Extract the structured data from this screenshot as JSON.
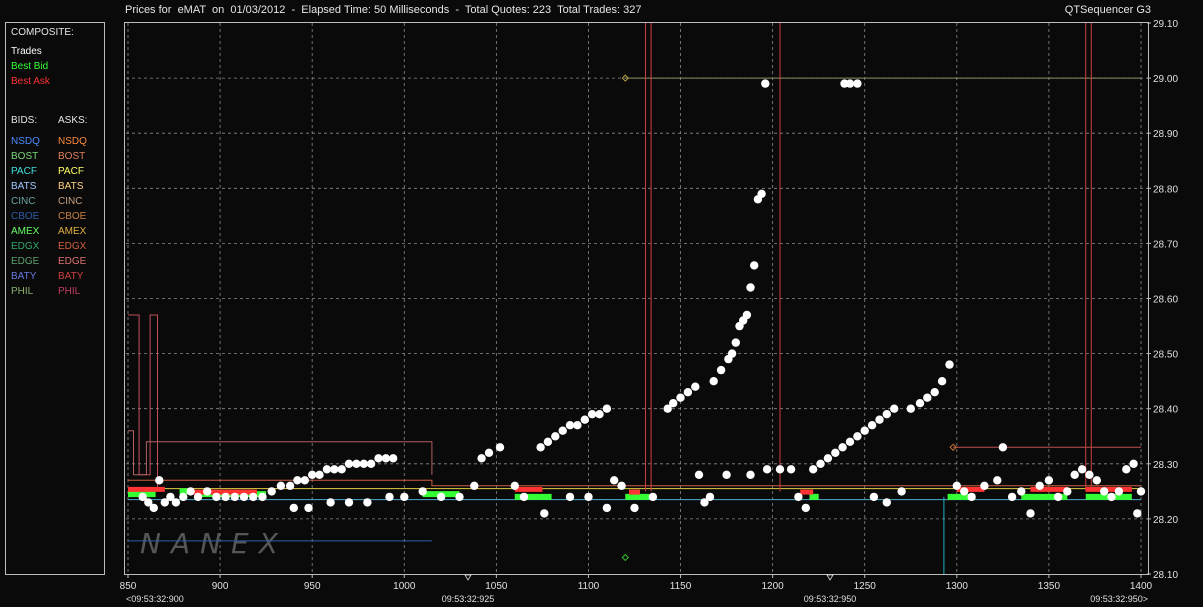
{
  "header": {
    "title": "Prices for  eMAT  on  01/03/2012  -  Elapsed Time: 50 Milliseconds  -  Total Quotes: 223  Total Trades: 327",
    "app_name": "QTSequencer G3"
  },
  "legend": {
    "composite_heading": "COMPOSITE:",
    "composite_items": [
      {
        "label": "Trades",
        "color": "#ffffff"
      },
      {
        "label": "Best Bid",
        "color": "#33ff33"
      },
      {
        "label": "Best Ask",
        "color": "#ff3333"
      }
    ],
    "bids_heading": "BIDS:",
    "asks_heading": "ASKS:",
    "exchanges": [
      {
        "bid": "NSDQ",
        "bid_color": "#4b8dff",
        "ask": "NSDQ",
        "ask_color": "#ff8c3a"
      },
      {
        "bid": "BOST",
        "bid_color": "#7ad77a",
        "ask": "BOST",
        "ask_color": "#e0805a"
      },
      {
        "bid": "PACF",
        "bid_color": "#40e0e0",
        "ask": "PACF",
        "ask_color": "#ffff66"
      },
      {
        "bid": "BATS",
        "bid_color": "#9fc8ff",
        "ask": "BATS",
        "ask_color": "#ffd080"
      },
      {
        "bid": "CINC",
        "bid_color": "#6aa6a6",
        "ask": "CINC",
        "ask_color": "#c8a080"
      },
      {
        "bid": "CBOE",
        "bid_color": "#2e5ea8",
        "ask": "CBOE",
        "ask_color": "#c88040"
      },
      {
        "bid": "AMEX",
        "bid_color": "#66ff66",
        "ask": "AMEX",
        "ask_color": "#e0b040"
      },
      {
        "bid": "EDGX",
        "bid_color": "#33a86a",
        "ask": "EDGX",
        "ask_color": "#d06040"
      },
      {
        "bid": "EDGE",
        "bid_color": "#5fa06f",
        "ask": "EDGE",
        "ask_color": "#e07070"
      },
      {
        "bid": "BATY",
        "bid_color": "#6a7ae0",
        "ask": "BATY",
        "ask_color": "#d04040"
      },
      {
        "bid": "PHIL",
        "bid_color": "#8ab070",
        "ask": "PHIL",
        "ask_color": "#c04060"
      }
    ]
  },
  "watermark": "NANEX",
  "chart_data": {
    "type": "scatter",
    "title": "Prices for  eMAT  on  01/03/2012",
    "x_ticks": [
      "850",
      "900",
      "950",
      "1000",
      "1050",
      "1100",
      "1150",
      "1200",
      "1250",
      "1300",
      "1350",
      "1400"
    ],
    "time_labels": [
      "<09:53:32:900",
      "09:53:32:925",
      "09:53:32:950",
      "09:53:32:950>"
    ],
    "y_ticks": [
      "28.10",
      "28.20",
      "28.30",
      "28.40",
      "28.50",
      "28.60",
      "28.70",
      "28.80",
      "28.90",
      "29.00",
      "29.10"
    ],
    "xlim": [
      850,
      1400
    ],
    "ylim": [
      28.1,
      29.1
    ],
    "grid": true,
    "series": [
      {
        "name": "Trades",
        "color": "#ffffff",
        "points": [
          [
            858,
            28.24
          ],
          [
            861,
            28.23
          ],
          [
            864,
            28.22
          ],
          [
            867,
            28.27
          ],
          [
            870,
            28.23
          ],
          [
            873,
            28.24
          ],
          [
            876,
            28.23
          ],
          [
            880,
            28.24
          ],
          [
            884,
            28.25
          ],
          [
            888,
            28.24
          ],
          [
            893,
            28.25
          ],
          [
            898,
            28.24
          ],
          [
            903,
            28.24
          ],
          [
            908,
            28.24
          ],
          [
            913,
            28.24
          ],
          [
            918,
            28.24
          ],
          [
            923,
            28.24
          ],
          [
            928,
            28.25
          ],
          [
            933,
            28.26
          ],
          [
            938,
            28.26
          ],
          [
            942,
            28.27
          ],
          [
            946,
            28.27
          ],
          [
            950,
            28.28
          ],
          [
            954,
            28.28
          ],
          [
            958,
            28.29
          ],
          [
            962,
            28.29
          ],
          [
            966,
            28.29
          ],
          [
            970,
            28.3
          ],
          [
            974,
            28.3
          ],
          [
            978,
            28.3
          ],
          [
            982,
            28.3
          ],
          [
            986,
            28.31
          ],
          [
            990,
            28.31
          ],
          [
            994,
            28.31
          ],
          [
            940,
            28.22
          ],
          [
            948,
            28.22
          ],
          [
            960,
            28.23
          ],
          [
            970,
            28.23
          ],
          [
            980,
            28.23
          ],
          [
            992,
            28.24
          ],
          [
            1000,
            28.24
          ],
          [
            1010,
            28.25
          ],
          [
            1020,
            28.24
          ],
          [
            1030,
            28.24
          ],
          [
            1038,
            28.26
          ],
          [
            1042,
            28.31
          ],
          [
            1046,
            28.32
          ],
          [
            1052,
            28.33
          ],
          [
            1060,
            28.26
          ],
          [
            1065,
            28.24
          ],
          [
            1074,
            28.33
          ],
          [
            1078,
            28.34
          ],
          [
            1082,
            28.35
          ],
          [
            1086,
            28.36
          ],
          [
            1090,
            28.37
          ],
          [
            1094,
            28.37
          ],
          [
            1098,
            28.38
          ],
          [
            1102,
            28.39
          ],
          [
            1106,
            28.39
          ],
          [
            1110,
            28.4
          ],
          [
            1114,
            28.27
          ],
          [
            1118,
            28.26
          ],
          [
            1076,
            28.21
          ],
          [
            1090,
            28.24
          ],
          [
            1100,
            28.24
          ],
          [
            1110,
            28.22
          ],
          [
            1125,
            28.22
          ],
          [
            1135,
            28.24
          ],
          [
            1143,
            28.4
          ],
          [
            1146,
            28.41
          ],
          [
            1150,
            28.42
          ],
          [
            1154,
            28.43
          ],
          [
            1158,
            28.44
          ],
          [
            1163,
            28.23
          ],
          [
            1166,
            28.24
          ],
          [
            1168,
            28.45
          ],
          [
            1172,
            28.47
          ],
          [
            1176,
            28.49
          ],
          [
            1178,
            28.5
          ],
          [
            1180,
            28.52
          ],
          [
            1182,
            28.55
          ],
          [
            1184,
            28.56
          ],
          [
            1186,
            28.57
          ],
          [
            1188,
            28.62
          ],
          [
            1190,
            28.66
          ],
          [
            1192,
            28.78
          ],
          [
            1194,
            28.79
          ],
          [
            1196,
            28.99
          ],
          [
            1160,
            28.28
          ],
          [
            1175,
            28.28
          ],
          [
            1188,
            28.28
          ],
          [
            1197,
            28.29
          ],
          [
            1204,
            28.29
          ],
          [
            1210,
            28.29
          ],
          [
            1214,
            28.24
          ],
          [
            1218,
            28.22
          ],
          [
            1222,
            28.29
          ],
          [
            1226,
            28.3
          ],
          [
            1230,
            28.31
          ],
          [
            1234,
            28.32
          ],
          [
            1238,
            28.33
          ],
          [
            1242,
            28.34
          ],
          [
            1246,
            28.35
          ],
          [
            1250,
            28.36
          ],
          [
            1254,
            28.37
          ],
          [
            1258,
            28.38
          ],
          [
            1262,
            28.39
          ],
          [
            1266,
            28.4
          ],
          [
            1239,
            28.99
          ],
          [
            1242,
            28.99
          ],
          [
            1246,
            28.99
          ],
          [
            1255,
            28.24
          ],
          [
            1262,
            28.23
          ],
          [
            1270,
            28.25
          ],
          [
            1275,
            28.4
          ],
          [
            1280,
            28.41
          ],
          [
            1284,
            28.42
          ],
          [
            1288,
            28.43
          ],
          [
            1292,
            28.45
          ],
          [
            1296,
            28.48
          ],
          [
            1300,
            28.26
          ],
          [
            1304,
            28.25
          ],
          [
            1308,
            28.24
          ],
          [
            1315,
            28.26
          ],
          [
            1322,
            28.27
          ],
          [
            1325,
            28.33
          ],
          [
            1330,
            28.24
          ],
          [
            1335,
            28.25
          ],
          [
            1340,
            28.21
          ],
          [
            1345,
            28.26
          ],
          [
            1350,
            28.27
          ],
          [
            1355,
            28.24
          ],
          [
            1360,
            28.25
          ],
          [
            1364,
            28.28
          ],
          [
            1368,
            28.29
          ],
          [
            1372,
            28.28
          ],
          [
            1376,
            28.27
          ],
          [
            1380,
            28.25
          ],
          [
            1384,
            28.24
          ],
          [
            1388,
            28.25
          ],
          [
            1392,
            28.29
          ],
          [
            1396,
            28.3
          ],
          [
            1398,
            28.21
          ],
          [
            1400,
            28.25
          ]
        ]
      },
      {
        "name": "Best Bid",
        "color": "#33ff33",
        "segments": [
          [
            850,
            865,
            28.245
          ],
          [
            878,
            885,
            28.25
          ],
          [
            890,
            925,
            28.245
          ],
          [
            1010,
            1030,
            28.245
          ],
          [
            1060,
            1080,
            28.24
          ],
          [
            1120,
            1133,
            28.24
          ],
          [
            1220,
            1225,
            28.24
          ],
          [
            1295,
            1310,
            28.24
          ],
          [
            1335,
            1360,
            28.24
          ],
          [
            1370,
            1395,
            28.24
          ]
        ]
      },
      {
        "name": "Best Ask",
        "color": "#ff3333",
        "segments": [
          [
            850,
            870,
            28.25
          ],
          [
            885,
            920,
            28.245
          ],
          [
            1060,
            1075,
            28.25
          ],
          [
            1122,
            1128,
            28.245
          ],
          [
            1215,
            1222,
            28.245
          ],
          [
            1300,
            1315,
            28.25
          ],
          [
            1340,
            1360,
            28.25
          ],
          [
            1370,
            1395,
            28.25
          ]
        ]
      }
    ]
  }
}
